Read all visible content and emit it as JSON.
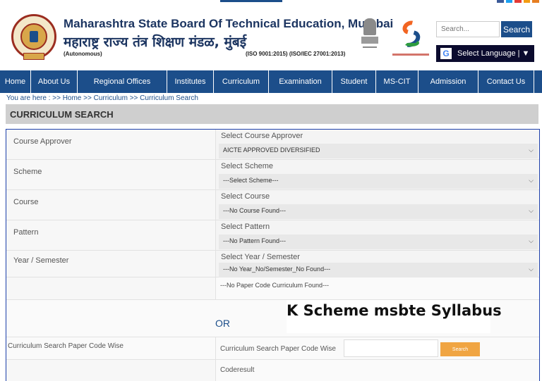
{
  "header": {
    "title_en": "Maharashtra State Board Of Technical Education, Mumbai",
    "title_mr": "महाराष्ट्र राज्य तंत्र शिक्षण मंडळ, मुंबई",
    "autonomous": "(Autonomous)",
    "iso": "(ISO 9001:2015) (ISO/IEC 27001:2013)",
    "search_placeholder": "Search...",
    "search_label": "Search",
    "language_label": "Select Language | ▼",
    "google_glyph": "G"
  },
  "nav": {
    "items": [
      "Home",
      "About Us",
      "Regional Offices",
      "Institutes",
      "Curriculum",
      "Examination",
      "Student",
      "MS-CIT",
      "Admission",
      "Contact Us"
    ]
  },
  "breadcrumb": "You are here : >> Home >> Curriculum >> Curriculum Search",
  "page_title": "CURRICULUM SEARCH",
  "form": {
    "rows": [
      {
        "label": "Course Approver",
        "caption": "Select Course Approver",
        "value": "AICTE APPROVED DIVERSIFIED"
      },
      {
        "label": "Scheme",
        "caption": "Select Scheme",
        "value": "---Select Scheme---"
      },
      {
        "label": "Course",
        "caption": "Select Course",
        "value": "---No Course Found---"
      },
      {
        "label": "Pattern",
        "caption": "Select Pattern",
        "value": "---No Pattern Found---"
      },
      {
        "label": "Year / Semester",
        "caption": "Select Year / Semester",
        "value": "---No Year_No/Semester_No Found---"
      }
    ],
    "no_paper_code": "---No Paper Code Curriculum Found---",
    "or_text": "OR",
    "k_scheme_banner": "K Scheme msbte Syllabus",
    "paper_code_label": "Curriculum Search Paper Code Wise",
    "paper_code_right_label": "Curriculum Search Paper Code Wise",
    "paper_code_button": "Search",
    "coderesult": "Coderesult"
  },
  "colors": {
    "nav_bg": "#1c4e8a",
    "heading_bar": "#cfcfcf",
    "search_button": "#f0a542",
    "panel_border": "#1c3faa"
  }
}
